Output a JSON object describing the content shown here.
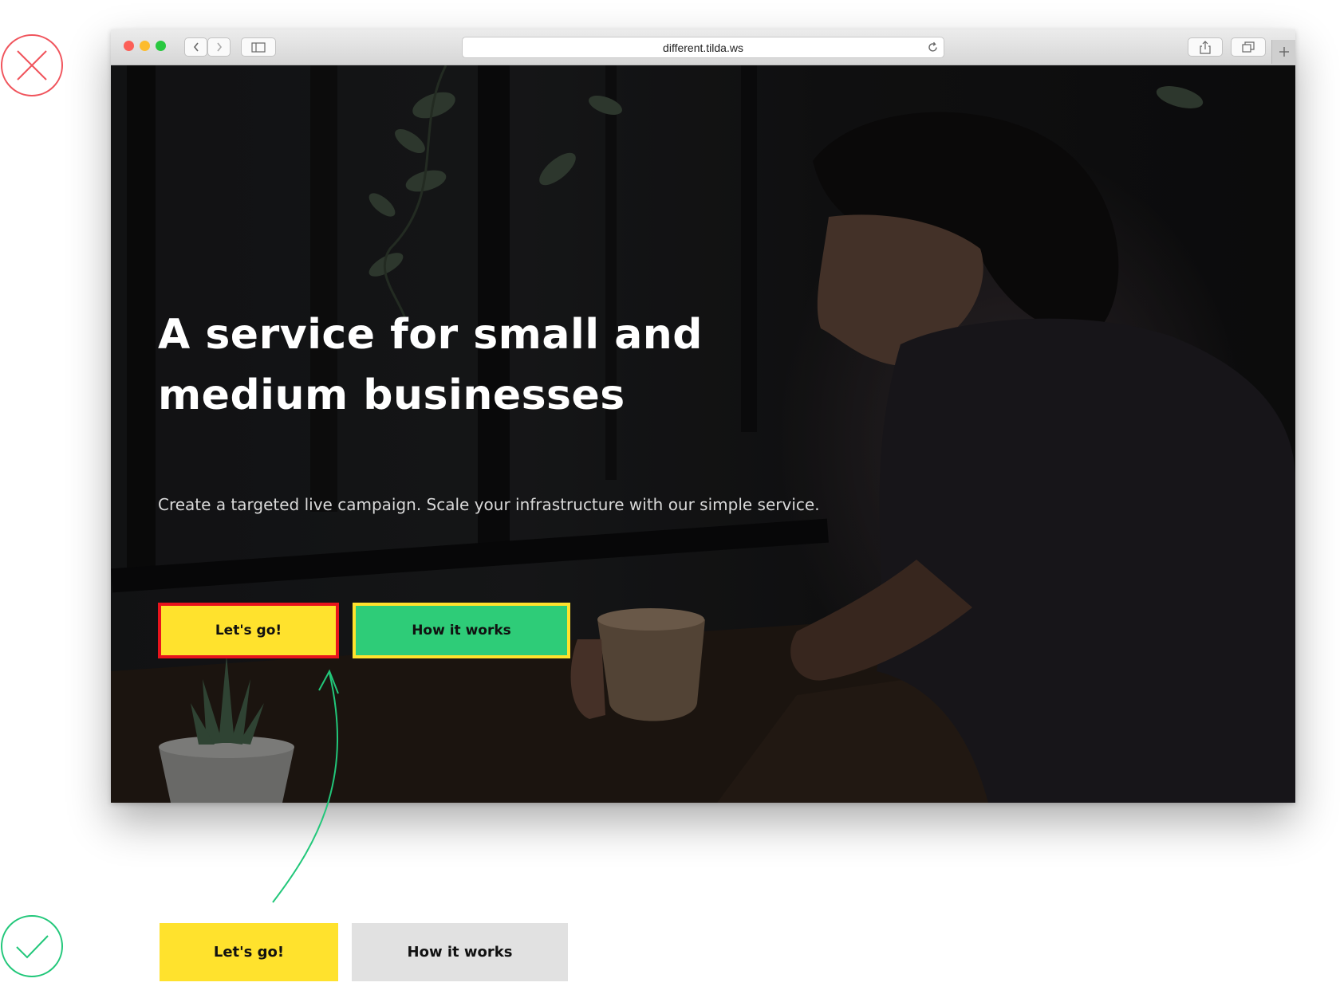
{
  "browser": {
    "url": "different.tilda.ws",
    "icons": {
      "back": "chevron-left-icon",
      "forward": "chevron-right-icon",
      "sidebar": "sidebar-icon",
      "reload": "reload-icon",
      "share": "share-icon",
      "tabs": "tabs-overview-icon",
      "new_tab": "plus-icon"
    }
  },
  "hero": {
    "title": "A service for small and medium businesses",
    "subtitle": "Create a targeted live campaign. Scale your infrastructure with our simple service.",
    "primary_label": "Let's go!",
    "secondary_label": "How it works"
  },
  "fixed": {
    "primary_label": "Let's go!",
    "secondary_label": "How it works"
  },
  "verdicts": {
    "wrong_icon": "cross-icon",
    "right_icon": "check-icon"
  },
  "colors": {
    "wrong": "#f0545c",
    "right": "#22c77a",
    "yellow": "#ffe22d",
    "green": "#2ecc78",
    "gray": "#e1e1e1",
    "red_border": "#e8141c",
    "yellow_border": "#ffe22d"
  }
}
